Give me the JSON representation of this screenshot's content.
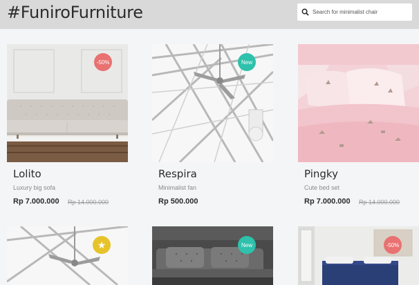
{
  "header": {
    "brand": "#FuniroFurniture",
    "search_placeholder": "Search for minimalist chair"
  },
  "products": [
    {
      "name": "Lolito",
      "desc": "Luxury big sofa",
      "price": "Rp 7.000.000",
      "old_price": "Rp 14.000.000",
      "badge": "-50%",
      "badge_type": "sale"
    },
    {
      "name": "Respira",
      "desc": "Minimalist fan",
      "price": "Rp 500.000",
      "old_price": "",
      "badge": "New",
      "badge_type": "new"
    },
    {
      "name": "Pingky",
      "desc": "Cute bed set",
      "price": "Rp 7.000.000",
      "old_price": "Rp 14.000.000",
      "badge": "",
      "badge_type": "none"
    }
  ],
  "row2_badges": [
    "★",
    "New",
    "-50%"
  ],
  "colors": {
    "sale": "#e97171",
    "new": "#2ec1ac",
    "star": "#e6c32a"
  }
}
